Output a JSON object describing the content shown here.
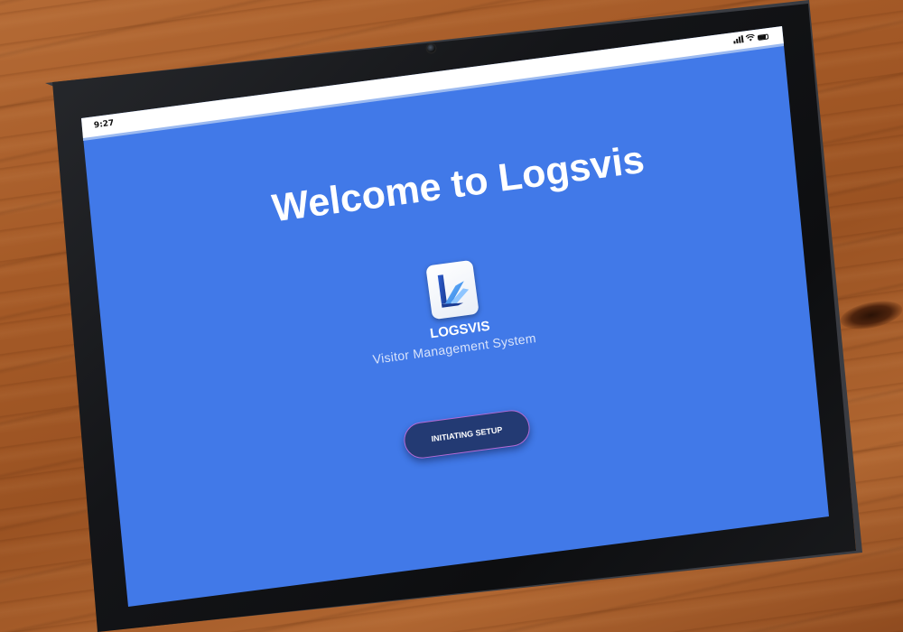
{
  "status_bar": {
    "time": "9:27"
  },
  "screen": {
    "welcome_title": "Welcome to Logsvis",
    "brand_name": "LOGSVIS",
    "tagline": "Visitor Management System",
    "setup_button_label": "INITIATING SETUP"
  },
  "icons": [
    "signal-icon",
    "wifi-icon",
    "battery-icon",
    "logsvis-logo-icon"
  ],
  "colors": {
    "screen_background": "#4179e8",
    "button_background": "#233a73",
    "button_border": "#b56ad6",
    "text": "#ffffff"
  }
}
